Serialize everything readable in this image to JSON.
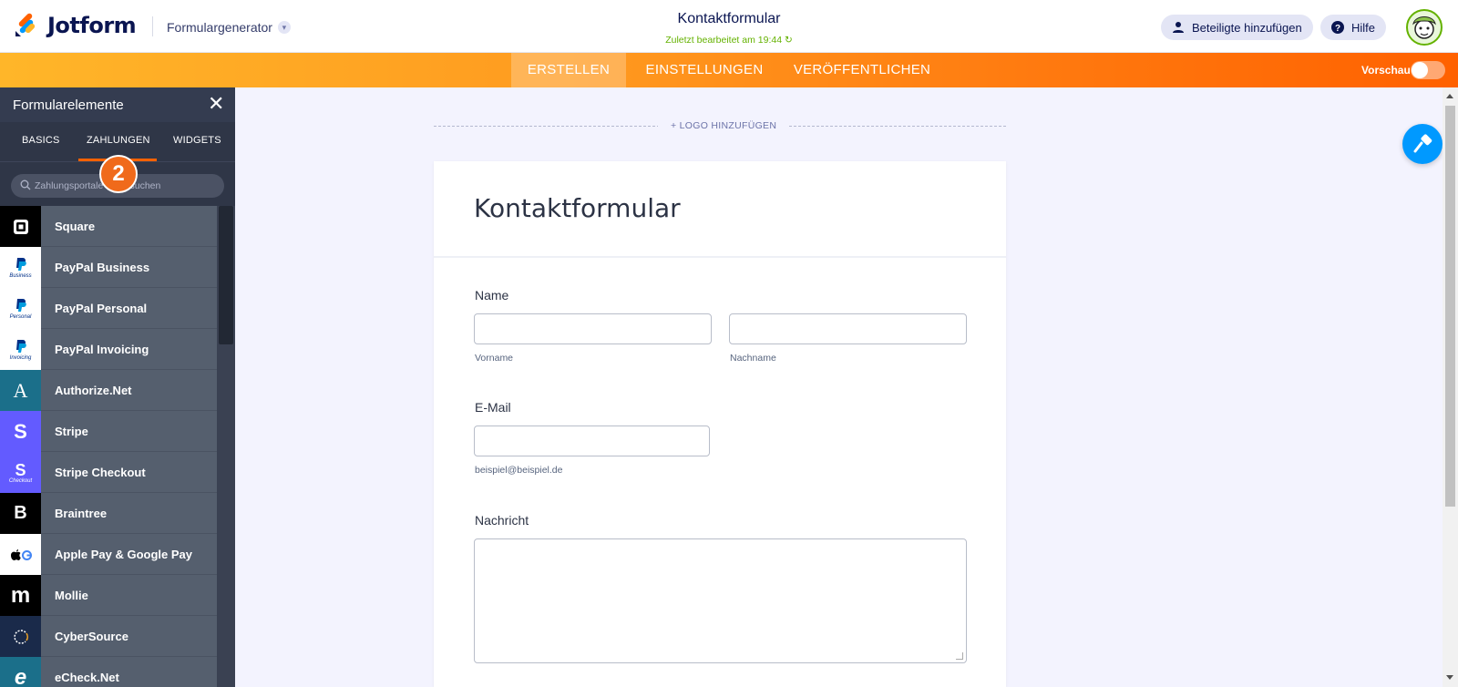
{
  "header": {
    "brand": "Jotform",
    "builder_label": "Formulargenerator",
    "form_title": "Kontaktformular",
    "saved_status": "Zuletzt bearbeitet am 19:44",
    "add_participants": "Beteiligte hinzufügen",
    "help": "Hilfe"
  },
  "nav": {
    "tabs": [
      "ERSTELLEN",
      "EINSTELLUNGEN",
      "VERÖFFENTLICHEN"
    ],
    "active_tab": "ERSTELLEN",
    "preview_label": "Vorschau",
    "preview_enabled": false
  },
  "sidebar": {
    "title": "Formularelemente",
    "tabs": [
      "BASICS",
      "ZAHLUNGEN",
      "WIDGETS"
    ],
    "active_tab": "ZAHLUNGEN",
    "step_badge": "2",
    "search_placeholder": "Zahlungsportale durchsuchen",
    "items": [
      {
        "label": "Square",
        "icon": "square-icon",
        "icon_bg": "#000000"
      },
      {
        "label": "PayPal Business",
        "icon": "paypal-business-icon",
        "icon_bg": "#ffffff",
        "icon_caption": "Business"
      },
      {
        "label": "PayPal Personal",
        "icon": "paypal-personal-icon",
        "icon_bg": "#ffffff",
        "icon_caption": "Personal"
      },
      {
        "label": "PayPal Invoicing",
        "icon": "paypal-invoicing-icon",
        "icon_bg": "#ffffff",
        "icon_caption": "Invoicing"
      },
      {
        "label": "Authorize.Net",
        "icon": "authorize-net-icon",
        "icon_bg": "#1b6f8a",
        "icon_glyph": "A"
      },
      {
        "label": "Stripe",
        "icon": "stripe-icon",
        "icon_bg": "#635bff",
        "icon_glyph": "S"
      },
      {
        "label": "Stripe Checkout",
        "icon": "stripe-checkout-icon",
        "icon_bg": "#635bff",
        "icon_glyph": "S",
        "icon_caption": "Checkout"
      },
      {
        "label": "Braintree",
        "icon": "braintree-icon",
        "icon_bg": "#000000",
        "icon_glyph": "B"
      },
      {
        "label": "Apple Pay & Google Pay",
        "icon": "apple-google-pay-icon",
        "icon_bg": "#ffffff"
      },
      {
        "label": "Mollie",
        "icon": "mollie-icon",
        "icon_bg": "#000000",
        "icon_glyph": "m"
      },
      {
        "label": "CyberSource",
        "icon": "cybersource-icon",
        "icon_bg": "#1a2a4a"
      },
      {
        "label": "eCheck.Net",
        "icon": "echeck-net-icon",
        "icon_bg": "#1b6f8a",
        "icon_glyph": "e"
      }
    ]
  },
  "canvas": {
    "add_logo": "+ LOGO HINZUFÜGEN",
    "form_heading": "Kontaktformular",
    "fields": {
      "name_label": "Name",
      "first_name_sub": "Vorname",
      "last_name_sub": "Nachname",
      "email_label": "E-Mail",
      "email_sub": "beispiel@beispiel.de",
      "message_label": "Nachricht"
    }
  },
  "colors": {
    "accent": "#ff6100",
    "brand_navy": "#0a1551",
    "saved_green": "#64b200",
    "fab_blue": "#0099ff"
  }
}
